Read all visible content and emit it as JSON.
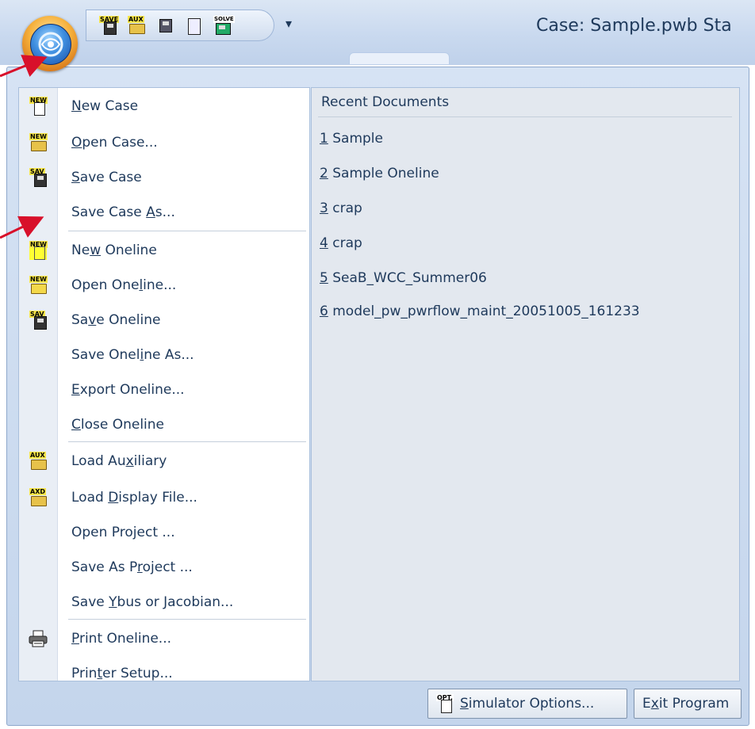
{
  "window": {
    "case_title": "Case: Sample.pwb  Sta",
    "qat_dropdown_glyph": "▾"
  },
  "quick_access": [
    {
      "name": "save-case-icon",
      "tag": "SAVE"
    },
    {
      "name": "load-aux-icon",
      "tag": "AUX"
    },
    {
      "name": "case-info-icon",
      "tag": ""
    },
    {
      "name": "log-icon",
      "tag": ""
    },
    {
      "name": "solve-icon",
      "tag": "SOLVE"
    }
  ],
  "menu": {
    "items": [
      {
        "pre": "",
        "key": "N",
        "post": "ew Case",
        "icon": "new-case-icon"
      },
      {
        "pre": "",
        "key": "O",
        "post": "pen Case...",
        "icon": "open-case-icon"
      },
      {
        "pre": "",
        "key": "S",
        "post": "ave Case",
        "icon": "save-case-icon"
      },
      {
        "pre": "Save Case ",
        "key": "A",
        "post": "s...",
        "icon": ""
      },
      {
        "pre": "Ne",
        "key": "w",
        "post": " Oneline",
        "icon": "new-oneline-icon"
      },
      {
        "pre": "Open One",
        "key": "l",
        "post": "ine...",
        "icon": "open-oneline-icon"
      },
      {
        "pre": "Sa",
        "key": "v",
        "post": "e Oneline",
        "icon": "save-oneline-icon"
      },
      {
        "pre": "Save Onel",
        "key": "i",
        "post": "ne As...",
        "icon": ""
      },
      {
        "pre": "",
        "key": "E",
        "post": "xport Oneline...",
        "icon": ""
      },
      {
        "pre": "",
        "key": "C",
        "post": "lose Oneline",
        "icon": ""
      },
      {
        "pre": "Load Au",
        "key": "x",
        "post": "iliary",
        "icon": "load-auxiliary-icon"
      },
      {
        "pre": "Load ",
        "key": "D",
        "post": "isplay File...",
        "icon": "load-display-icon"
      },
      {
        "pre": "Open Pro",
        "key": "j",
        "post": "ect ...",
        "icon": ""
      },
      {
        "pre": "Save As P",
        "key": "r",
        "post": "oject ...",
        "icon": ""
      },
      {
        "pre": "Save ",
        "key": "Y",
        "post": "bus or Jacobian...",
        "icon": ""
      },
      {
        "pre": "",
        "key": "P",
        "post": "rint Oneline...",
        "icon": "printer-icon"
      },
      {
        "pre": "Prin",
        "key": "t",
        "post": "er Setup...",
        "icon": ""
      }
    ]
  },
  "recent": {
    "header": "Recent Documents",
    "items": [
      {
        "num": "1",
        "name": " Sample"
      },
      {
        "num": "2",
        "name": " Sample Oneline"
      },
      {
        "num": "3",
        "name": " crap"
      },
      {
        "num": "4",
        "name": " crap"
      },
      {
        "num": "5",
        "name": " SeaB_WCC_Summer06"
      },
      {
        "num": "6",
        "name": " model_pw_pwrflow_maint_20051005_161233"
      }
    ]
  },
  "footer": {
    "options": {
      "pre": "",
      "key": "S",
      "post": "imulator Options...",
      "icon_tag": "OPT."
    },
    "exit": {
      "pre": "E",
      "key": "x",
      "post": "it Program"
    }
  },
  "colors": {
    "menu_text": "#1e395b",
    "icon_highlight": "#ffff33",
    "arrow": "#d8102a"
  }
}
